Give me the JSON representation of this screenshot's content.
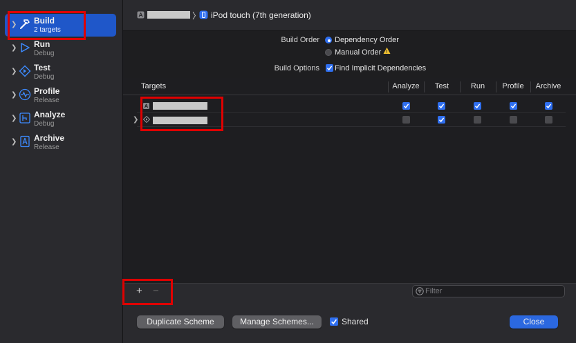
{
  "sidebar": {
    "items": [
      {
        "title": "Build",
        "subtitle": "2 targets",
        "icon": "hammer-icon"
      },
      {
        "title": "Run",
        "subtitle": "Debug",
        "icon": "play-icon"
      },
      {
        "title": "Test",
        "subtitle": "Debug",
        "icon": "test-diamond-icon"
      },
      {
        "title": "Profile",
        "subtitle": "Release",
        "icon": "profile-wave-icon"
      },
      {
        "title": "Analyze",
        "subtitle": "Debug",
        "icon": "analyze-bracket-icon"
      },
      {
        "title": "Archive",
        "subtitle": "Release",
        "icon": "archive-doc-icon"
      }
    ]
  },
  "header": {
    "separator": "〉",
    "device": "iPod touch (7th generation)"
  },
  "build_order": {
    "label": "Build Order",
    "options": [
      "Dependency Order",
      "Manual Order"
    ],
    "selected": "Dependency Order"
  },
  "build_options": {
    "label": "Build Options",
    "find_implicit_label": "Find Implicit Dependencies",
    "find_implicit_checked": true
  },
  "table": {
    "columns": [
      "Targets",
      "Analyze",
      "Test",
      "Run",
      "Profile",
      "Archive"
    ],
    "rows": [
      {
        "analyze": true,
        "test": true,
        "run": true,
        "profile": true,
        "archive": true
      },
      {
        "analyze": false,
        "test": true,
        "run": false,
        "profile": false,
        "archive": false
      }
    ]
  },
  "toolbar": {
    "add_label": "+",
    "remove_label": "−",
    "filter_placeholder": "Filter"
  },
  "footer": {
    "duplicate_label": "Duplicate Scheme",
    "manage_label": "Manage Schemes...",
    "shared_label": "Shared",
    "shared_checked": true,
    "close_label": "Close"
  },
  "colors": {
    "accent": "#2f6ff0",
    "selection": "#1f57c9",
    "annotation": "#e00000"
  }
}
